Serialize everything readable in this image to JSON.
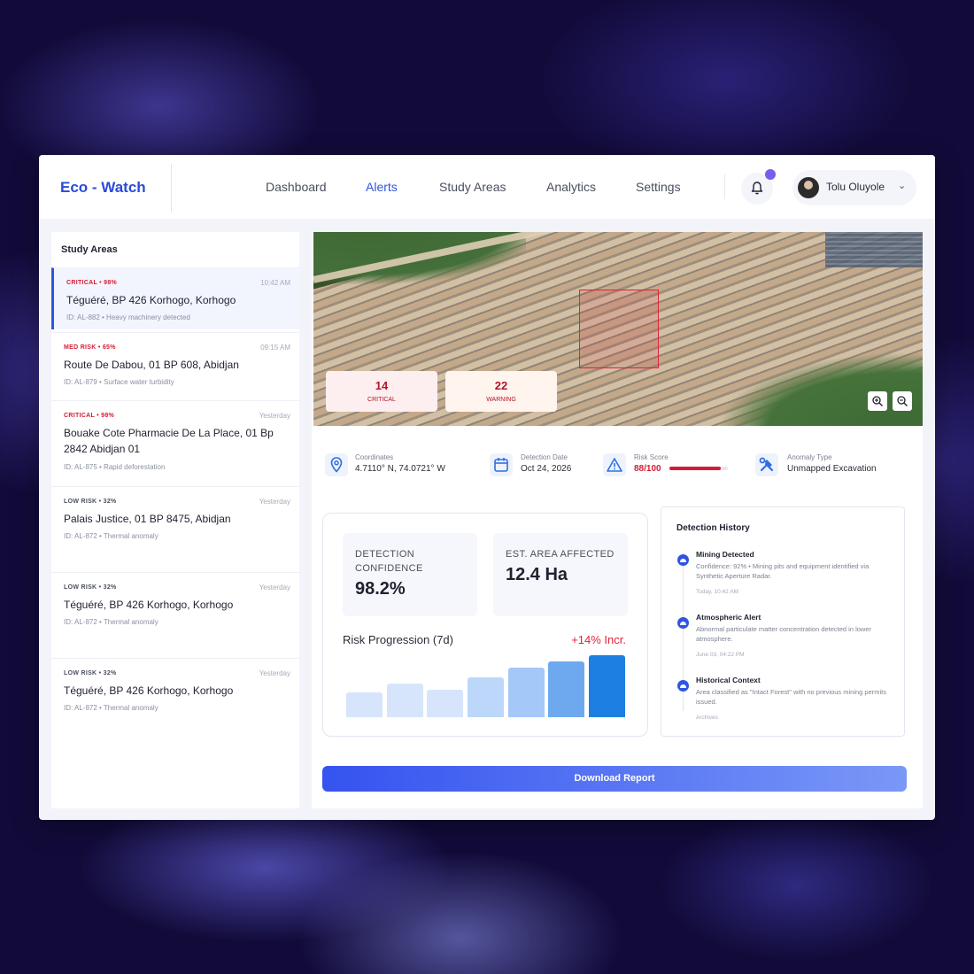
{
  "brand": "Eco - Watch",
  "nav": [
    "Dashboard",
    "Alerts",
    "Study Areas",
    "Analytics",
    "Settings"
  ],
  "user": {
    "name": "Tolu Oluyole"
  },
  "sidebar": {
    "title": "Study Areas",
    "items": [
      {
        "tag": "CRITICAL • 98%",
        "time": "10:42 AM",
        "name": "Téguéré, BP 426 Korhogo, Korhogo",
        "meta": "ID: AL-882 • Heavy machinery detected"
      },
      {
        "tag": "MED RISK • 65%",
        "time": "09:15 AM",
        "name": "Route De Dabou, 01 BP 608, Abidjan",
        "meta": "ID: AL-879 • Surface water turbidity"
      },
      {
        "tag": "CRITICAL • 98%",
        "time": "Yesterday",
        "name": "Bouake Cote Pharmacie De La Place, 01 Bp 2842 Abidjan 01",
        "meta": "ID: AL-875 • Rapid deforestation"
      },
      {
        "tag": "LOW RISK • 32%",
        "time": "Yesterday",
        "name": "Palais Justice, 01 BP 8475, Abidjan",
        "meta": "ID: AL-872 • Thermal anomaly"
      },
      {
        "tag": "LOW RISK • 32%",
        "time": "Yesterday",
        "name": "Téguéré, BP 426 Korhogo, Korhogo",
        "meta": "ID: AL-872 • Thermal anomaly"
      },
      {
        "tag": "LOW RISK • 32%",
        "time": "Yesterday",
        "name": "Téguéré, BP 426 Korhogo, Korhogo",
        "meta": "ID: AL-872 • Thermal anomaly"
      }
    ]
  },
  "hero": {
    "critical": {
      "value": "14",
      "label": "CRITICAL"
    },
    "warning": {
      "value": "22",
      "label": "WARNING"
    }
  },
  "info": {
    "coordinates": {
      "label": "Coordinates",
      "value": "4.7110° N, 74.0721° W"
    },
    "detection_date": {
      "label": "Detection Date",
      "value": "Oct 24, 2026"
    },
    "risk_score": {
      "label": "Risk Score",
      "value": "88/100",
      "fraction": 0.88
    },
    "anomaly_type": {
      "label": "Anomaly Type",
      "value": "Unmapped Excavation"
    }
  },
  "metrics": {
    "confidence": {
      "label": "DETECTION CONFIDENCE",
      "value": "98.2%"
    },
    "area": {
      "label": "EST. AREA AFFECTED",
      "value": "12.4 Ha"
    },
    "risk_progression": {
      "title": "Risk Progression (7d)",
      "delta": "+14% Incr."
    }
  },
  "chart_data": {
    "type": "bar",
    "categories": [
      "1",
      "2",
      "3",
      "4",
      "5",
      "6",
      "7"
    ],
    "values": [
      40,
      55,
      45,
      65,
      80,
      90,
      100
    ],
    "ylim": [
      0,
      100
    ],
    "colors": [
      "#d6e5fb",
      "#d6e5fb",
      "#d6e5fb",
      "#bcd7f9",
      "#a4c8f7",
      "#6ea9f0",
      "#1e7fe3"
    ]
  },
  "history": {
    "title": "Detection History",
    "events": [
      {
        "head": "Mining Detected",
        "desc": "Confidence: 92% • Mining pits and equipment identified via Synthetic Aperture Radar.",
        "time": "Today, 10:42 AM"
      },
      {
        "head": "Atmospheric Alert",
        "desc": "Abnormal particulate matter concentration detected in lower atmosphere.",
        "time": "June 03, 04:22 PM"
      },
      {
        "head": "Historical Context",
        "desc": "Area classified as \"Intact Forest\" with no previous mining permits issued.",
        "time": "Archives"
      }
    ]
  },
  "download_label": "Download Report",
  "colors": {
    "accent": "#2f55e0",
    "critical": "#d51c36",
    "brand": "#2a4bd7"
  }
}
